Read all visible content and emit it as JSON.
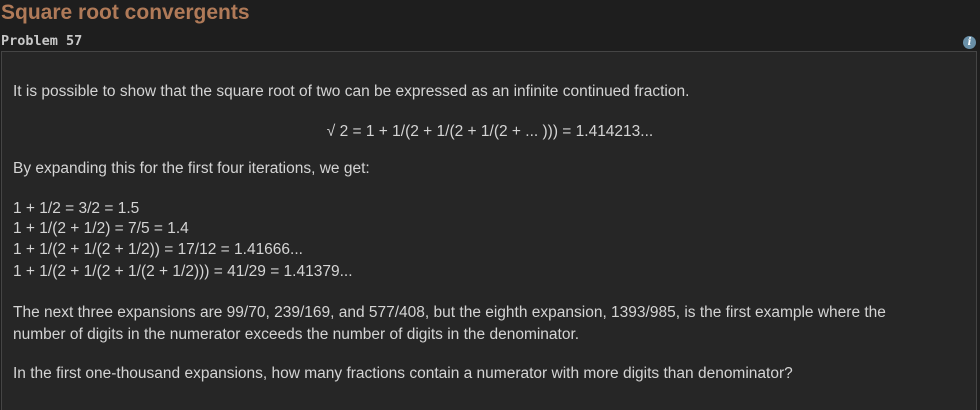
{
  "header": {
    "title": "Square root convergents",
    "problem_number": "Problem 57",
    "info_icon": "info-icon"
  },
  "problem": {
    "intro": "It is possible to show that the square root of two can be expressed as an infinite continued fraction.",
    "formula": "√ 2 = 1 + 1/(2 + 1/(2 + 1/(2 + ... ))) = 1.414213...",
    "expansion_intro": "By expanding this for the first four iterations, we get:",
    "iterations": [
      "1 + 1/2 = 3/2 = 1.5",
      "1 + 1/(2 + 1/2) = 7/5 = 1.4",
      "1 + 1/(2 + 1/(2 + 1/2)) = 17/12 = 1.41666...",
      "1 + 1/(2 + 1/(2 + 1/(2 + 1/2))) = 41/29 = 1.41379..."
    ],
    "next_line_1": "The next three expansions are 99/70, 239/169, and 577/408, but the eighth expansion, 1393/985, is the first example where the",
    "next_line_2": "number of digits in the numerator exceeds the number of digits in the denominator.",
    "question": "In the first one-thousand expansions, how many fractions contain a numerator with more digits than denominator?"
  },
  "colors": {
    "background": "#1e1e1e",
    "panel": "#262626",
    "title": "#b07a58",
    "text": "#d4d4d4",
    "info_icon": "#6a90a8"
  }
}
